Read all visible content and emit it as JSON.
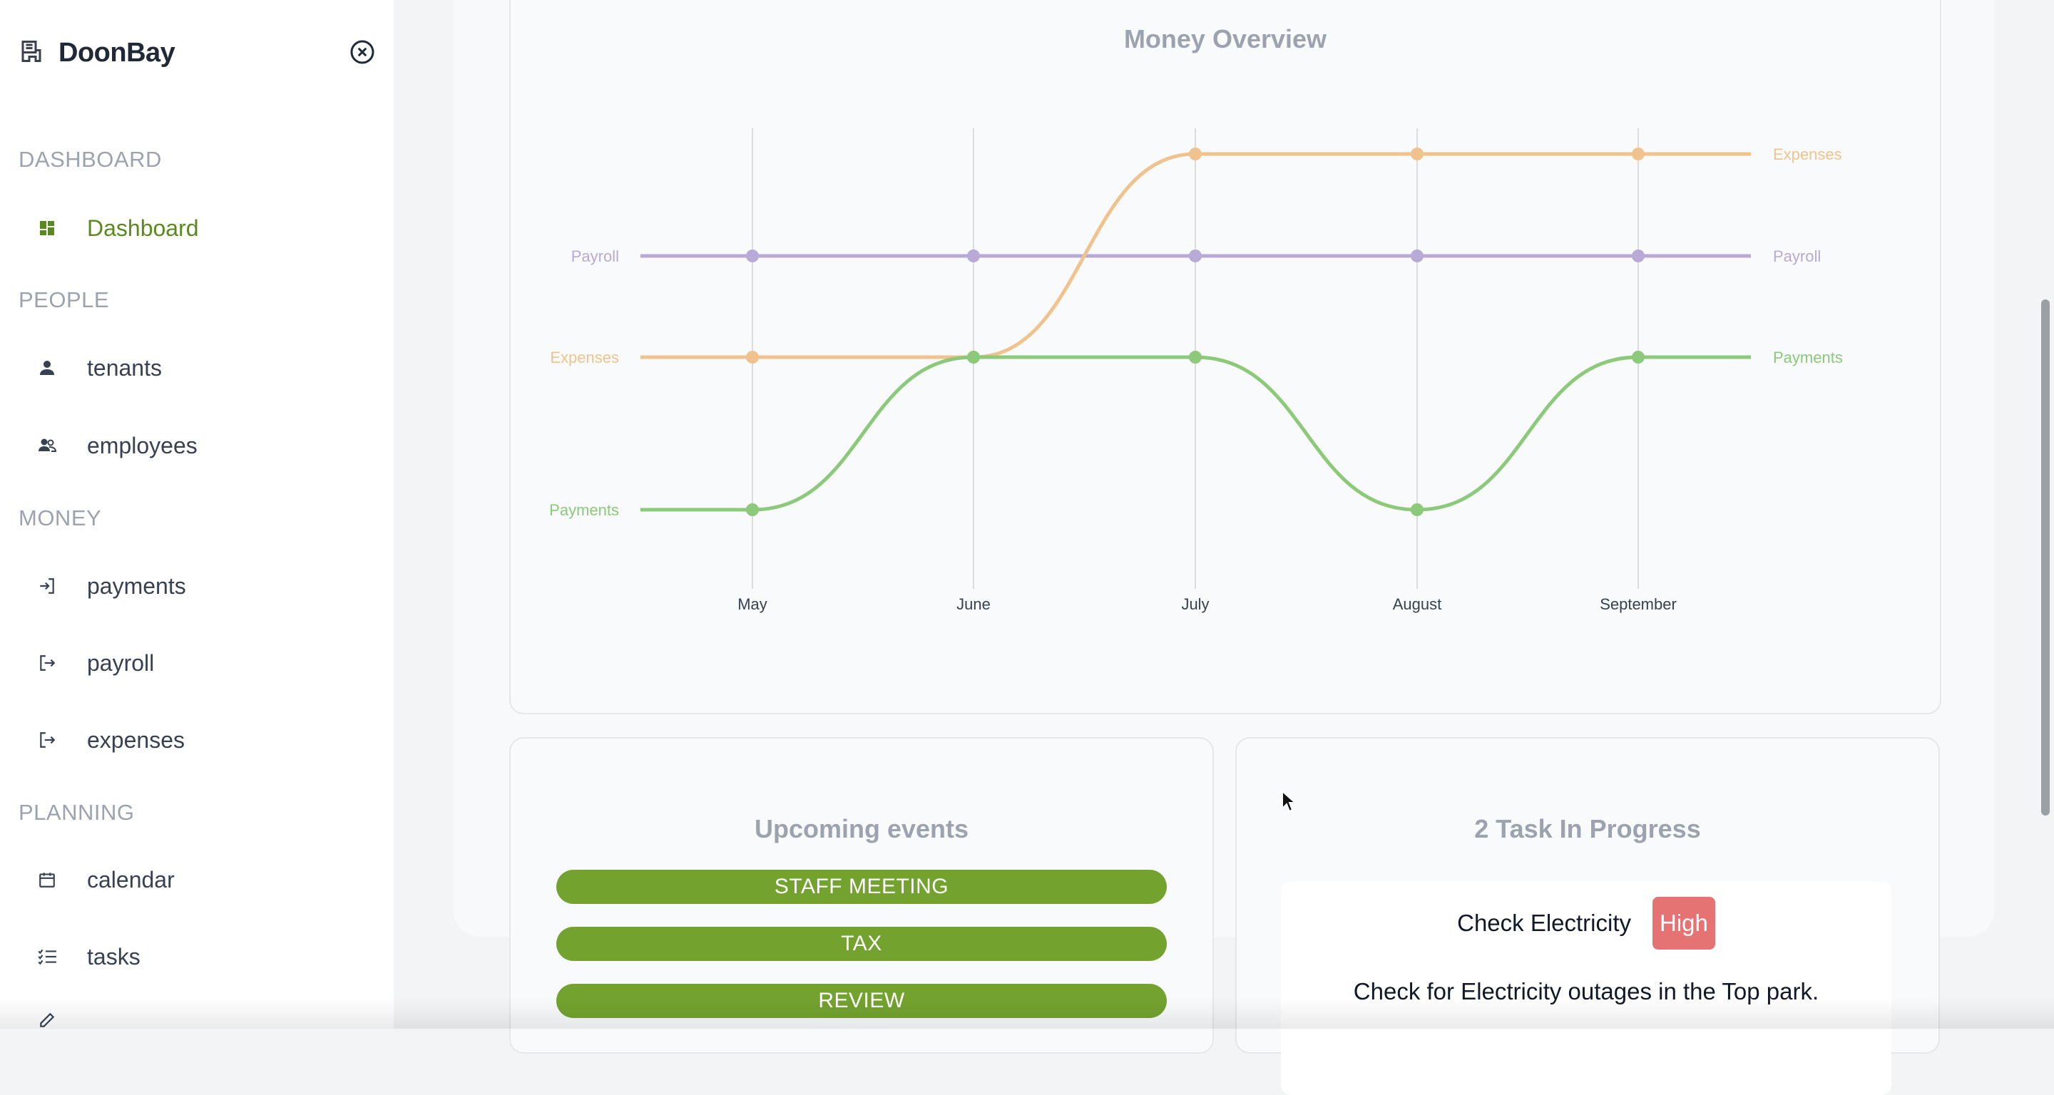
{
  "app": {
    "title": "DoonBay"
  },
  "sidebar": {
    "sections": [
      {
        "label": "DASHBOARD"
      },
      {
        "label": "PEOPLE"
      },
      {
        "label": "MONEY"
      },
      {
        "label": "PLANNING"
      }
    ],
    "items": [
      {
        "label": "Dashboard",
        "icon": "dashboard-icon",
        "active": true
      },
      {
        "label": "tenants",
        "icon": "person-icon"
      },
      {
        "label": "employees",
        "icon": "people-icon"
      },
      {
        "label": "payments",
        "icon": "login-icon"
      },
      {
        "label": "payroll",
        "icon": "logout-icon"
      },
      {
        "label": "expenses",
        "icon": "logout-icon"
      },
      {
        "label": "calendar",
        "icon": "calendar-icon"
      },
      {
        "label": "tasks",
        "icon": "checklist-icon"
      }
    ]
  },
  "chart": {
    "title": "Money Overview"
  },
  "chart_data": {
    "type": "line",
    "title": "Money Overview",
    "categories": [
      "May",
      "June",
      "July",
      "August",
      "September"
    ],
    "series": [
      {
        "name": "Payroll",
        "color": "#b8a9d6",
        "ranks": [
          2,
          2,
          2,
          2,
          2
        ]
      },
      {
        "name": "Expenses",
        "color": "#f0c38e",
        "ranks": [
          3,
          3,
          1,
          1,
          1
        ]
      },
      {
        "name": "Payments",
        "color": "#8cc97a",
        "ranks": [
          4,
          3,
          3,
          4,
          3
        ]
      }
    ],
    "grid": true,
    "legend": "inline-labels-left-and-right"
  },
  "events": {
    "title": "Upcoming events",
    "items": [
      "STAFF MEETING",
      "TAX",
      "REVIEW"
    ],
    "color": "#73a22f"
  },
  "tasks": {
    "title": "2 Task In Progress",
    "items": [
      {
        "name": "Check Electricity",
        "priority": "High",
        "description": "Check for Electricity outages in the Top park.",
        "priority_color": "#e57373"
      }
    ]
  }
}
